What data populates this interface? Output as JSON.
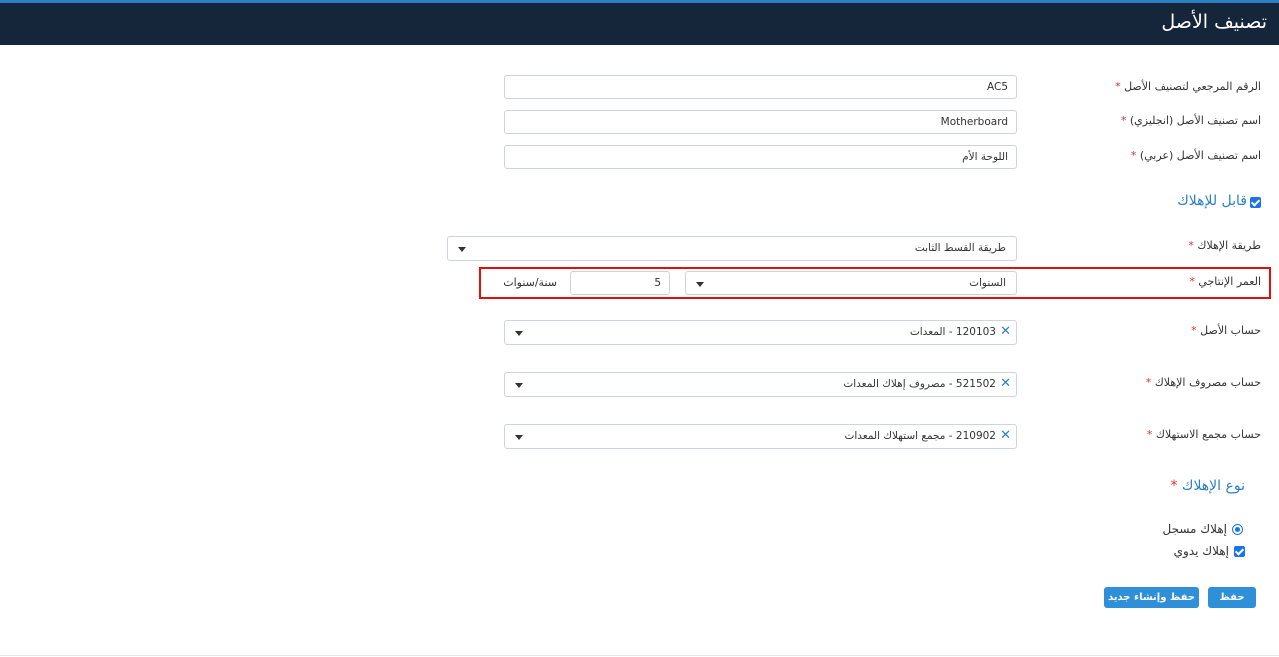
{
  "header": {
    "title": "تصنيف الأصل"
  },
  "form": {
    "ref_no": {
      "label": "الرقم المرجعي لتصنيف الأصل",
      "value": "AC5"
    },
    "name_en": {
      "label": "اسم تصنيف الأصل (انجليزي)",
      "value": "Motherboard"
    },
    "name_ar": {
      "label": "اسم تصنيف الأصل (عربي)",
      "value": "اللوحة الأم"
    },
    "depreciable": {
      "label": "قابل للإهلاك",
      "checked": true
    },
    "depreciation_method": {
      "label": "طريقة الإهلاك",
      "value": "طريقة القسط الثابت"
    },
    "useful_life": {
      "label": "العمر الإنتاجي",
      "unit_select": "السنوات",
      "value": "5",
      "suffix": "سنة/سنوات"
    },
    "asset_account": {
      "label": "حساب الأصل",
      "value": "120103 - المعدات"
    },
    "depr_expense_account": {
      "label": "حساب مصروف الإهلاك",
      "value": "521502 - مصروف إهلاك المعدات"
    },
    "accum_depr_account": {
      "label": "حساب مجمع الاستهلاك",
      "value": "210902 - مجمع استهلاك المعدات"
    },
    "depreciation_type": {
      "label": "نوع الإهلاك",
      "options": [
        {
          "label": "إهلاك مسجل",
          "control": "radio",
          "selected": true
        },
        {
          "label": "إهلاك يدوي",
          "control": "checkbox",
          "selected": true
        }
      ]
    },
    "required_mark": "*"
  },
  "buttons": {
    "save": "حفظ",
    "save_new": "حفظ وإنشاء جديد"
  },
  "colors": {
    "header_bg": "#15253a",
    "accent": "#2c7fc4",
    "button": "#2f8fd8",
    "required": "#d9332a",
    "highlight": "#e30f0f"
  }
}
